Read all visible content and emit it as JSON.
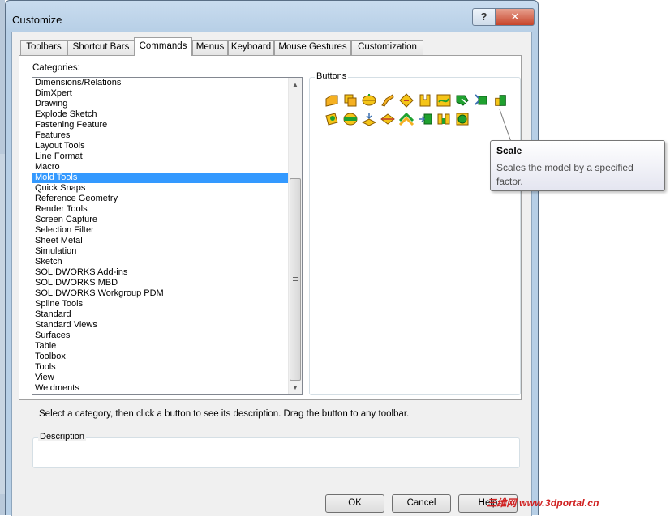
{
  "window": {
    "title": "Customize",
    "help_glyph": "?",
    "close_glyph": "✕"
  },
  "tabs": [
    {
      "label": "Toolbars"
    },
    {
      "label": "Shortcut Bars"
    },
    {
      "label": "Commands",
      "active": true
    },
    {
      "label": "Menus"
    },
    {
      "label": "Keyboard"
    },
    {
      "label": "Mouse Gestures"
    },
    {
      "label": "Customization"
    }
  ],
  "categories": {
    "label": "Categories:",
    "selected": "Mold Tools",
    "items": [
      "Dimensions/Relations",
      "DimXpert",
      "Drawing",
      "Explode Sketch",
      "Fastening Feature",
      "Features",
      "Layout Tools",
      "Line Format",
      "Macro",
      "Mold Tools",
      "Quick Snaps",
      "Reference Geometry",
      "Render Tools",
      "Screen Capture",
      "Selection Filter",
      "Sheet Metal",
      "Simulation",
      "Sketch",
      "SOLIDWORKS Add-ins",
      "SOLIDWORKS MBD",
      "SOLIDWORKS Workgroup PDM",
      "Spline Tools",
      "Standard",
      "Standard Views",
      "Surfaces",
      "Table",
      "Toolbox",
      "Tools",
      "View",
      "Weldments"
    ]
  },
  "buttons_group": {
    "title": "Buttons",
    "row1": [
      "planar-surface-icon",
      "offset-surface-icon",
      "ruled-surface-icon",
      "parting-line-icon",
      "shut-off-surface-icon",
      "core-icon",
      "draft-analysis-icon",
      "tooling-split-icon",
      "insert-mold-folders-icon",
      "scale-icon"
    ],
    "row2": [
      "undercut-analysis-icon",
      "parting-surface-icon",
      "move-face-icon",
      "split-line-icon",
      "knit-surface-icon",
      "cavity-icon",
      "shell-icon",
      "combine-icon"
    ],
    "selected": "scale-icon"
  },
  "tooltip": {
    "title": "Scale",
    "description": "Scales the model by a specified factor."
  },
  "hint": "Select a category, then click a button to see its description. Drag the button to any toolbar.",
  "description": {
    "title": "Description",
    "text": ""
  },
  "dialog_buttons": {
    "ok": "OK",
    "cancel": "Cancel",
    "help": "Help"
  },
  "watermark": "三维网 www.3dportal.cn",
  "colors": {
    "selection": "#3399ff",
    "frame": "#b7cfe6",
    "icon_yellow": "#f5c518",
    "icon_green": "#1fa12f"
  }
}
